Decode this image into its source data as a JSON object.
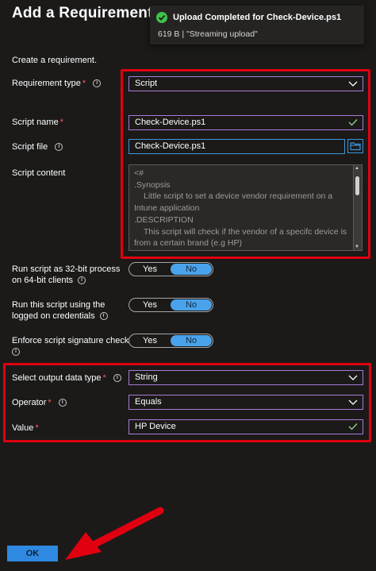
{
  "header": {
    "title": "Add a Requirement"
  },
  "toast": {
    "title": "Upload Completed for Check-Device.ps1",
    "subtitle": "619 B | \"Streaming upload\""
  },
  "intro": "Create a requirement.",
  "fields": {
    "requirement_type": {
      "label": "Requirement type",
      "value": "Script"
    },
    "script_name": {
      "label": "Script name",
      "value": "Check-Device.ps1"
    },
    "script_file": {
      "label": "Script file",
      "value": "Check-Device.ps1"
    },
    "script_content": {
      "label": "Script content",
      "lines": [
        "<#",
        ".Synopsis",
        "Little script to set a device vendor requirement on a",
        "Intune application",
        ".DESCRIPTION",
        "This script will check if the vendor of a specifc device is",
        "from a certain brand (e.g HP)"
      ]
    },
    "run_32bit": {
      "label_line1": "Run script as 32-bit process",
      "label_line2": "on 64-bit clients",
      "yes": "Yes",
      "no": "No",
      "selected": "No"
    },
    "run_logged_on": {
      "label_line1": "Run this script using the",
      "label_line2": "logged on credentials",
      "yes": "Yes",
      "no": "No",
      "selected": "No"
    },
    "enforce_signature": {
      "label": "Enforce script signature check",
      "yes": "Yes",
      "no": "No",
      "selected": "No"
    },
    "output_type": {
      "label": "Select output data type",
      "value": "String"
    },
    "operator": {
      "label": "Operator",
      "value": "Equals"
    },
    "value": {
      "label": "Value",
      "value": "HP Device"
    }
  },
  "footer": {
    "ok_label": "OK"
  },
  "icons": {
    "toast": "success-check-icon",
    "info": "info-icon",
    "dropdown": "chevron-down-icon",
    "valid": "checkmark-icon",
    "browse": "folder-icon"
  },
  "colors": {
    "background": "#1b1a19",
    "highlight": "#e00010",
    "field_border_purple": "#a97bd6",
    "accent_blue": "#2f89e0",
    "toggle_on": "#4aa3ea",
    "success": "#3fc34a",
    "required": "#ff5a5a"
  }
}
